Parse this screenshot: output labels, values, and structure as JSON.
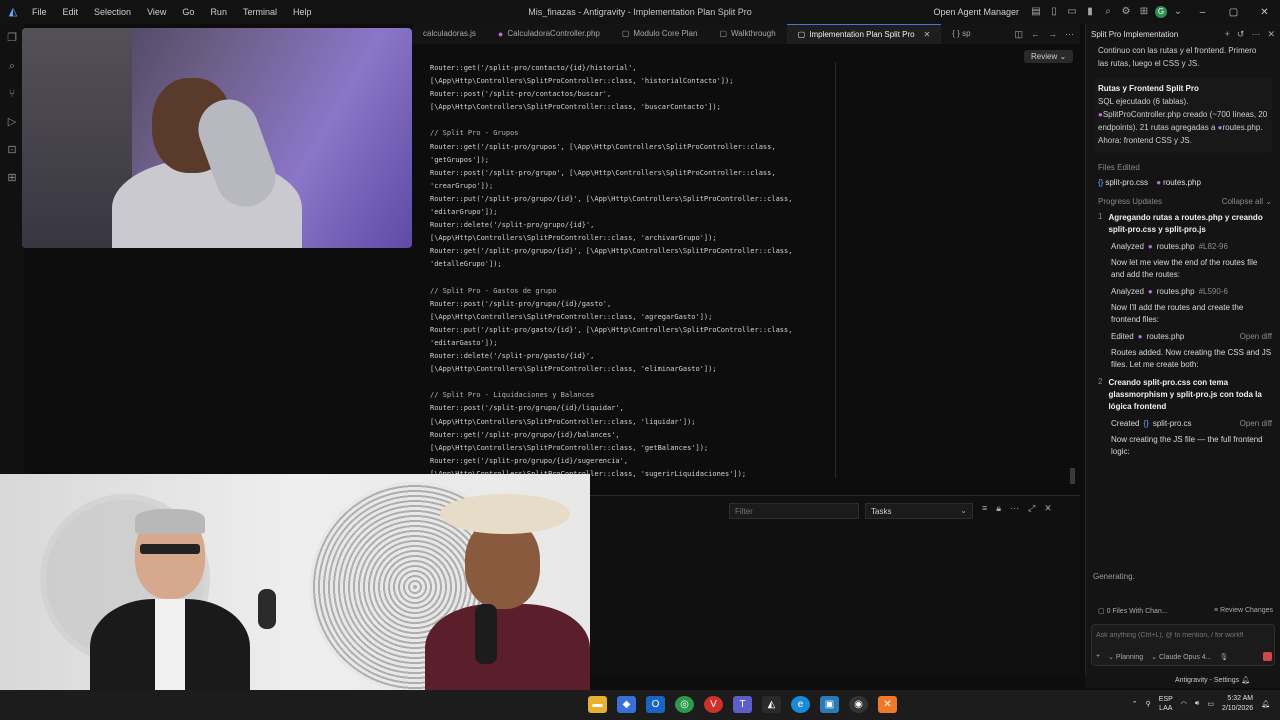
{
  "menu": [
    "File",
    "Edit",
    "Selection",
    "View",
    "Go",
    "Run",
    "Terminal",
    "Help"
  ],
  "window_title": "Mis_finazas - Antigravity - Implementation Plan Split Pro",
  "title_right": {
    "open_agent_manager": "Open Agent Manager",
    "avatar_letter": "G"
  },
  "tabs": [
    {
      "label": "calculadoras.js",
      "active": false
    },
    {
      "label": "CalculadoraController.php",
      "active": false
    },
    {
      "label": "Modulo Core Plan",
      "active": false
    },
    {
      "label": "Walkthrough",
      "active": false
    },
    {
      "label": "Implementation Plan Split Pro",
      "active": true
    },
    {
      "label": "{ } sp",
      "active": false
    }
  ],
  "review_button": "Review",
  "code_lines": [
    "Router::get('/split-pro/contacto/{id}/historial',",
    "[\\App\\Http\\Controllers\\SplitProController::class, 'historialContacto']);",
    "Router::post('/split-pro/contactos/buscar',",
    "[\\App\\Http\\Controllers\\SplitProController::class, 'buscarContacto']);",
    "",
    "// Split Pro - Grupos",
    "Router::get('/split-pro/grupos', [\\App\\Http\\Controllers\\SplitProController::class,",
    "'getGrupos']);",
    "Router::post('/split-pro/grupo', [\\App\\Http\\Controllers\\SplitProController::class,",
    "'crearGrupo']);",
    "Router::put('/split-pro/grupo/{id}', [\\App\\Http\\Controllers\\SplitProController::class,",
    "'editarGrupo']);",
    "Router::delete('/split-pro/grupo/{id}',",
    "[\\App\\Http\\Controllers\\SplitProController::class, 'archivarGrupo']);",
    "Router::get('/split-pro/grupo/{id}', [\\App\\Http\\Controllers\\SplitProController::class,",
    "'detalleGrupo']);",
    "",
    "// Split Pro - Gastos de grupo",
    "Router::post('/split-pro/grupo/{id}/gasto',",
    "[\\App\\Http\\Controllers\\SplitProController::class, 'agregarGasto']);",
    "Router::put('/split-pro/gasto/{id}', [\\App\\Http\\Controllers\\SplitProController::class,",
    "'editarGasto']);",
    "Router::delete('/split-pro/gasto/{id}',",
    "[\\App\\Http\\Controllers\\SplitProController::class, 'eliminarGasto']);",
    "",
    "// Split Pro - Liquidaciones y Balances",
    "Router::post('/split-pro/grupo/{id}/liquidar',",
    "[\\App\\Http\\Controllers\\SplitProController::class, 'liquidar']);",
    "Router::get('/split-pro/grupo/{id}/balances',",
    "[\\App\\Http\\Controllers\\SplitProController::class, 'getBalances']);",
    "Router::get('/split-pro/grupo/{id}/sugerencia',",
    "[\\App\\Http\\Controllers\\SplitProController::class, 'sugerirLiquidaciones']);"
  ],
  "panel": {
    "filter_placeholder": "Filter",
    "tasks_label": "Tasks"
  },
  "agent": {
    "header": "Split Pro Implementation",
    "intro": "Continuo con las rutas y el frontend. Primero las rutas, luego el CSS y JS.",
    "card_title": "Rutas y Frontend Split Pro",
    "card_sql": "SQL ejecutado (6 tablas).",
    "card_file": "SplitProController.php",
    "card_rest1": "creado (~700 líneas, 20 endpoints). 21 rutas agregadas a",
    "card_routes": "routes.php",
    "card_rest2": ". Ahora: frontend CSS y JS.",
    "files_edited_label": "Files Edited",
    "files_edited": [
      "split-pro.css",
      "routes.php"
    ],
    "progress_label": "Progress Updates",
    "collapse_label": "Collapse all",
    "step1_num": "1",
    "step1_title": "Agregando rutas a routes.php y creando split-pro.css y split-pro.js",
    "analyzed1": {
      "label": "Analyzed",
      "file": "routes.php",
      "range": "#L82-96"
    },
    "msg1": "Now let me view the end of the routes file and add the routes:",
    "analyzed2": {
      "label": "Analyzed",
      "file": "routes.php",
      "range": "#L590-6"
    },
    "msg2": "Now I'll add the routes and create the frontend files:",
    "edited": {
      "label": "Edited",
      "file": "routes.php",
      "action": "Open diff"
    },
    "msg3": "Routes added. Now creating the CSS and JS files. Let me create both:",
    "step2_num": "2",
    "step2_title": "Creando split-pro.css con tema glassmorphism y split-pro.js con toda la lógica frontend",
    "created": {
      "label": "Created",
      "file": "split-pro.cs",
      "action": "Open diff"
    },
    "msg4": "Now creating the JS file — the full frontend logic:",
    "generating": "Generating.",
    "files_changes": "0 Files With Chan...",
    "review_changes": "Review Changes",
    "ask_placeholder": "Ask anything (Ctrl+L), @ to mention, / for workfl",
    "mode": "Planning",
    "model": "Claude Opus 4..."
  },
  "status": {
    "settings": "Antigravity - Settings"
  },
  "taskbar": {
    "lang_top": "ESP",
    "lang_bottom": "LAA",
    "time": "5:32 AM",
    "date": "2/10/2026"
  },
  "colors": {
    "accent": "#3a7bd5",
    "php_icon": "#b070e0",
    "stop": "#c94a4a"
  }
}
